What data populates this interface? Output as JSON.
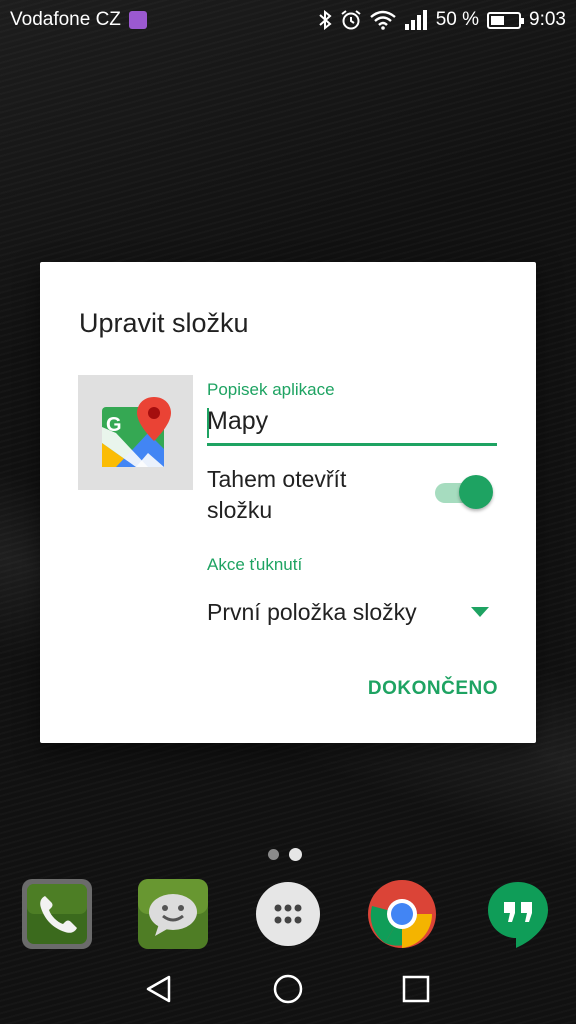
{
  "statusbar": {
    "carrier": "Vodafone CZ",
    "battery_text": "50 %",
    "battery_level": 0.5,
    "time": "9:03",
    "icons": [
      "gallery-icon",
      "bluetooth-icon",
      "alarm-icon",
      "wifi-icon",
      "signal-icon",
      "battery-icon"
    ]
  },
  "dialog": {
    "title": "Upravit složku",
    "app_icon": "google-maps-icon",
    "app_label_caption": "Popisek aplikace",
    "app_label_value": "Mapy",
    "swipe_toggle_label": "Tahem otevřít složku",
    "swipe_toggle_on": true,
    "tap_action_caption": "Akce ťuknutí",
    "tap_action_value": "První položka složky",
    "done_label": "DOKONČENO"
  },
  "home": {
    "page_count": 2,
    "active_page": 1,
    "dock": [
      "phone-icon",
      "messages-icon",
      "app-drawer-icon",
      "chrome-icon",
      "hangouts-icon"
    ]
  },
  "navbar": [
    "back-icon",
    "home-icon",
    "recents-icon"
  ],
  "colors": {
    "accent": "#1ea362",
    "accent_light": "#a6dcbf"
  }
}
